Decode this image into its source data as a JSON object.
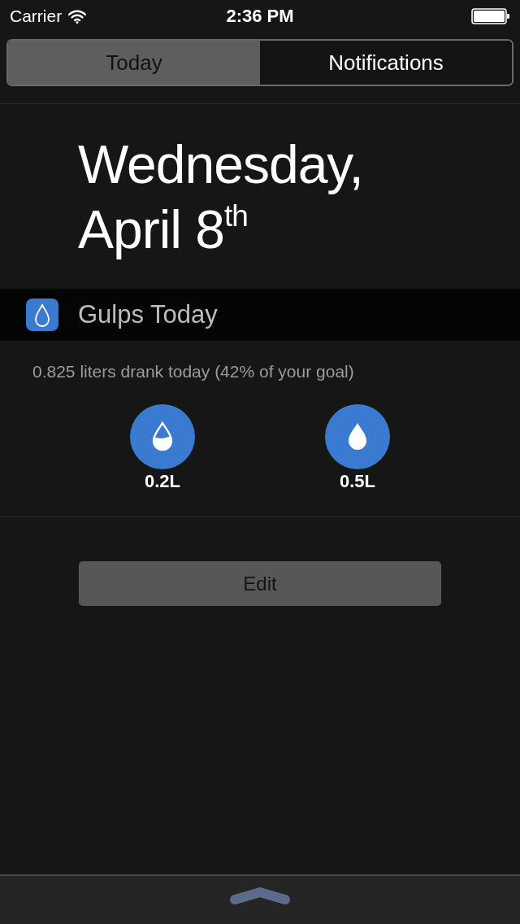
{
  "status_bar": {
    "carrier": "Carrier",
    "time": "2:36 PM"
  },
  "tabs": [
    {
      "label": "Today",
      "selected": true
    },
    {
      "label": "Notifications",
      "selected": false
    }
  ],
  "date": "Wednesday, April 8$^{th}$",
  "widget": {
    "title": "Gulps Today",
    "summary": "0.825 liters drank today (42% of your goal)",
    "drinks": [
      {
        "label": "0.2L",
        "kind": "half"
      },
      {
        "label": "0.5L",
        "kind": "full"
      }
    ]
  },
  "edit_button": {
    "label": "Edit"
  }
}
